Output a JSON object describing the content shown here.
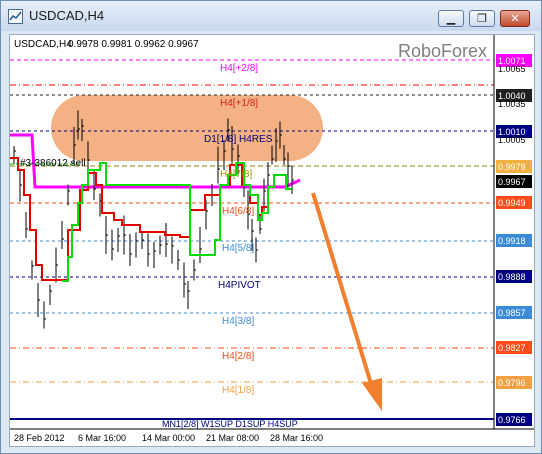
{
  "window": {
    "title": "USDCAD,H4",
    "minimize_glyph": "▁",
    "restore_glyph": "❐",
    "close_glyph": "✕"
  },
  "chart_header": {
    "symbol_tf": "USDCAD,H4",
    "ohlc": "0.9978 0.9981 0.9962 0.9967"
  },
  "watermark": "RoboForex",
  "order_label": "#3-386012 sell",
  "price_labels": {
    "level_top": "1.0071",
    "level_top_hidden": "1.0065",
    "p1": "1.0040",
    "p1_hidden": "1.0035",
    "p2": "1.0010",
    "p2_hidden": "1.0005",
    "p3": "0.9979",
    "current": "0.9967",
    "p4": "0.9949",
    "p5": "0.9918",
    "p6": "0.9888",
    "p7": "0.9857",
    "p8": "0.9827",
    "p9": "0.9796",
    "p10": "0.9766"
  },
  "level_labels": {
    "l_plus2": "H4[+2/8]",
    "l_plus1": "H4[+1/8]",
    "l_d1": "D1[1/8] H4RES",
    "l_78": "H4[7/8]",
    "l_68": "H4[6/8]",
    "l_58": "H4[5/8]",
    "l_pivot": "H4PIVOT",
    "l_38": "H4[3/8]",
    "l_28": "H4[2/8]",
    "l_18": "H4[1/8]",
    "l_bottom": "MN1[2/8] W1SUP D1SUP H4SUP"
  },
  "time_labels": [
    "28 Feb 2012",
    "6 Mar 16:00",
    "14 Mar 00:00",
    "21 Mar 08:00",
    "28 Mar 16:00"
  ],
  "colors": {
    "chart_bg": "#ffffff",
    "bars": "#000000",
    "magenta": "#ff00ff",
    "red_line": "#ff0000",
    "green_line": "#00dd00",
    "orange_zone": "#f4b183",
    "arrow": "#f07f30",
    "navy": "#000080"
  }
}
